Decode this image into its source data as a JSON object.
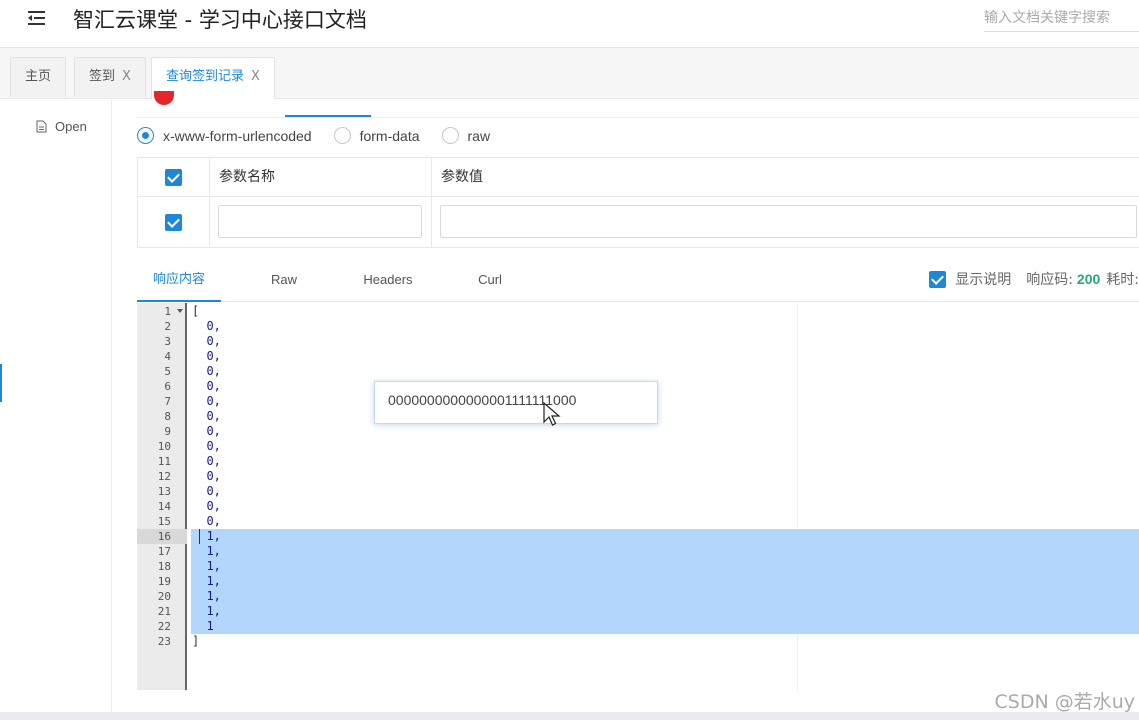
{
  "header": {
    "menu_icon": "menu-fold-icon",
    "title": "智汇云课堂 - 学习中心接口文档",
    "search_placeholder": "输入文档关键字搜索"
  },
  "tabs": [
    {
      "label": "主页",
      "closable": false,
      "active": false
    },
    {
      "label": "签到",
      "closable": true,
      "close_symbol": "X",
      "active": false
    },
    {
      "label": "查询签到记录",
      "closable": true,
      "close_symbol": "X",
      "active": true
    }
  ],
  "sidebar": {
    "items": [
      {
        "label": "Open",
        "icon": "document-icon"
      }
    ]
  },
  "body_type": {
    "options": [
      {
        "label": "x-www-form-urlencoded",
        "checked": true
      },
      {
        "label": "form-data",
        "checked": false
      },
      {
        "label": "raw",
        "checked": false
      }
    ]
  },
  "params": {
    "header_checked": true,
    "col_name": "参数名称",
    "col_value": "参数值",
    "rows": [
      {
        "checked": true,
        "name": "",
        "value": ""
      }
    ]
  },
  "response": {
    "tabs": [
      "响应内容",
      "Raw",
      "Headers",
      "Curl"
    ],
    "active_tab": 0,
    "show_desc_checked": true,
    "show_desc_label": "显示说明",
    "code_label": "响应码:",
    "code_value": "200",
    "time_label": "耗时:",
    "accent_color": "#1e88d6",
    "code_color": "#27a57e"
  },
  "editor": {
    "line_numbers": [
      "1",
      "2",
      "3",
      "4",
      "5",
      "6",
      "7",
      "8",
      "9",
      "10",
      "11",
      "12",
      "13",
      "14",
      "15",
      "16",
      "17",
      "18",
      "19",
      "20",
      "21",
      "22",
      "23"
    ],
    "lines": [
      "[",
      "  0,",
      "  0,",
      "  0,",
      "  0,",
      "  0,",
      "  0,",
      "  0,",
      "  0,",
      "  0,",
      "  0,",
      "  0,",
      "  0,",
      "  0,",
      "  0,",
      "  1,",
      "  1,",
      "  1,",
      "  1,",
      "  1,",
      "  1,",
      "  1",
      "]"
    ],
    "active_line": 16,
    "selected_from": 16,
    "selected_to": 22,
    "selection_color": "#b3d6fc"
  },
  "popup": {
    "text": "0000000000000001111111000"
  },
  "watermark": "CSDN @若水uy"
}
